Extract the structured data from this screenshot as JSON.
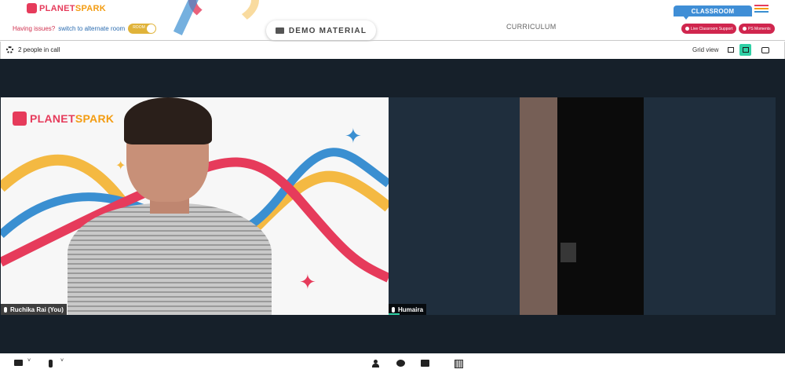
{
  "header": {
    "logo_text_a": "PLANET",
    "logo_text_b": "SPARK",
    "issues_text": "Having issues?",
    "switch_link": "switch to alternate room",
    "toggle_label": "ROOM",
    "demo_material": "DEMO MATERIAL",
    "curriculum": "CURRICULUM",
    "classroom_tab": "CLASSROOM",
    "live_support": "Live Classroom Support",
    "ps_moments": "PS Moments"
  },
  "toolbar": {
    "people_count": "2 people in call",
    "grid_view": "Grid view"
  },
  "tiles": [
    {
      "name": "Ruchika Rai (You)",
      "background_logo_a": "PLANET",
      "background_logo_b": "SPARK"
    },
    {
      "name": "Humaira"
    }
  ],
  "icons": {
    "settings": "gear-icon",
    "speaker_view": "sidebar-layout-icon",
    "grid_view": "grid-layout-icon",
    "chat_toggle": "chat-bubbles-icon",
    "camera": "video-camera-icon",
    "mic": "microphone-icon",
    "participants": "person-icon",
    "chat": "chat-icon",
    "screen_share": "screen-share-icon",
    "whiteboard": "whiteboard-icon"
  },
  "colors": {
    "brand_red": "#e63b5b",
    "classroom_blue": "#3f8ed6",
    "active_view": "#2fd0a5",
    "stage_bg": "#16202a"
  }
}
